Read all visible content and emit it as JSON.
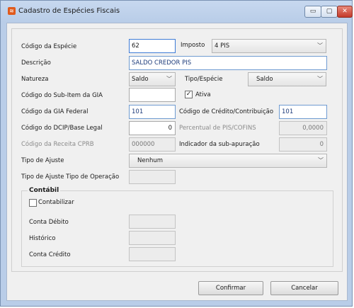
{
  "window": {
    "title": "Cadastro de Espécies Fiscais",
    "icon": "app-icon",
    "min_glyph": "▭",
    "max_glyph": "▢",
    "close_glyph": "✕",
    "app_glyph": "≋"
  },
  "form": {
    "codigo_especie": {
      "label": "Código da Espécie",
      "value": "62"
    },
    "imposto": {
      "label": "Imposto",
      "value": "4 PIS"
    },
    "descricao": {
      "label": "Descrição",
      "value": "SALDO CREDOR PIS"
    },
    "natureza": {
      "label": "Natureza",
      "value": "Saldo"
    },
    "tipo_especie": {
      "label": "Tipo/Espécie",
      "value": "Saldo"
    },
    "sub_item_gia": {
      "label": "Código do Sub-Item da GIA",
      "value": ""
    },
    "ativa": {
      "label": "Ativa",
      "checked": true,
      "mark": "✓"
    },
    "gia_federal": {
      "label": "Código da GIA Federal",
      "value": "101"
    },
    "credito_contribuicao": {
      "label": "Código de Crédito/Contribuição",
      "value": "101"
    },
    "dcip_base_legal": {
      "label": "Código do DCIP/Base Legal",
      "value": "0"
    },
    "percentual_pis_cofins": {
      "label": "Percentual de PIS/COFINS",
      "value": "0,0000"
    },
    "receita_cprb": {
      "label": "Código da Receita CPRB",
      "value": "000000"
    },
    "indicador_subapuracao": {
      "label": "Indicador da sub-apuração",
      "value": "0"
    },
    "tipo_ajuste": {
      "label": "Tipo de Ajuste",
      "value": "Nenhum"
    },
    "tipo_ajuste_operacao": {
      "label": "Tipo de Ajuste Tipo de Operação",
      "value": ""
    }
  },
  "contabil": {
    "title": "Contábil",
    "contabilizar": {
      "label": "Contabilizar",
      "checked": false
    },
    "conta_debito": {
      "label": "Conta Débito",
      "value": ""
    },
    "historico": {
      "label": "Histórico",
      "value": ""
    },
    "conta_credito": {
      "label": "Conta Crédito",
      "value": ""
    }
  },
  "buttons": {
    "confirmar": "Confirmar",
    "cancelar": "Cancelar"
  },
  "dropdown_glyph": "﹀"
}
